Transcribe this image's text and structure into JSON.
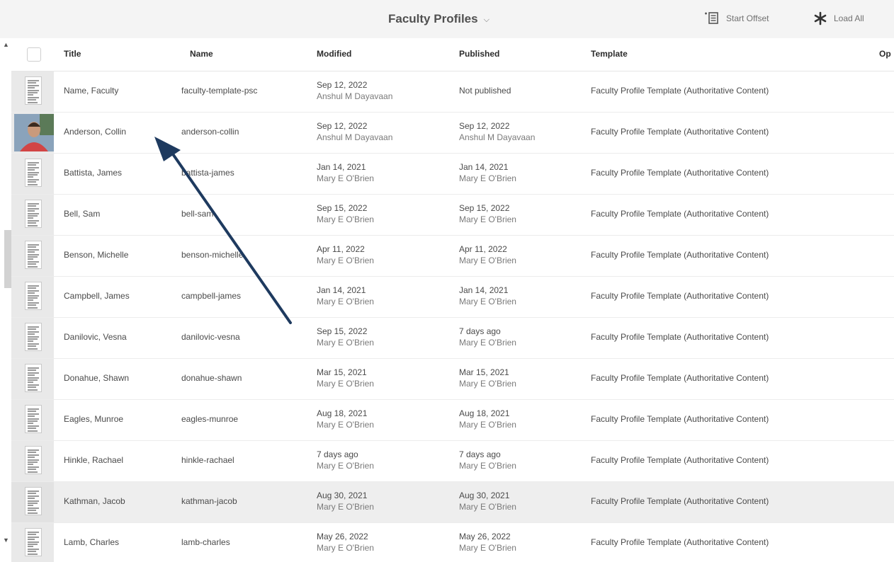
{
  "header": {
    "title": "Faculty Profiles",
    "start_offset": "Start Offset",
    "load_all": "Load All"
  },
  "columns": {
    "title": "Title",
    "name": "Name",
    "modified": "Modified",
    "published": "Published",
    "template": "Template",
    "truncated": "Op"
  },
  "rows": [
    {
      "title": "Name, Faculty",
      "name": "faculty-template-psc",
      "mod_date": "Sep 12, 2022",
      "mod_by": "Anshul M Dayavaan",
      "pub_date": "Not published",
      "pub_by": "",
      "template": "Faculty Profile Template (Authoritative Content)",
      "thumb": "document-icon"
    },
    {
      "title": "Anderson, Collin",
      "name": "anderson-collin",
      "mod_date": "Sep 12, 2022",
      "mod_by": "Anshul M Dayavaan",
      "pub_date": "Sep 12, 2022",
      "pub_by": "Anshul M Dayavaan",
      "template": "Faculty Profile Template (Authoritative Content)",
      "thumb": "profile-photo"
    },
    {
      "title": "Battista, James",
      "name": "battista-james",
      "mod_date": "Jan 14, 2021",
      "mod_by": "Mary E O'Brien",
      "pub_date": "Jan 14, 2021",
      "pub_by": "Mary E O'Brien",
      "template": "Faculty Profile Template (Authoritative Content)",
      "thumb": "document-icon"
    },
    {
      "title": "Bell, Sam",
      "name": "bell-sam",
      "mod_date": "Sep 15, 2022",
      "mod_by": "Mary E O'Brien",
      "pub_date": "Sep 15, 2022",
      "pub_by": "Mary E O'Brien",
      "template": "Faculty Profile Template (Authoritative Content)",
      "thumb": "document-icon"
    },
    {
      "title": "Benson, Michelle",
      "name": "benson-michelle",
      "mod_date": "Apr 11, 2022",
      "mod_by": "Mary E O'Brien",
      "pub_date": "Apr 11, 2022",
      "pub_by": "Mary E O'Brien",
      "template": "Faculty Profile Template (Authoritative Content)",
      "thumb": "document-icon"
    },
    {
      "title": "Campbell, James",
      "name": "campbell-james",
      "mod_date": "Jan 14, 2021",
      "mod_by": "Mary E O'Brien",
      "pub_date": "Jan 14, 2021",
      "pub_by": "Mary E O'Brien",
      "template": "Faculty Profile Template (Authoritative Content)",
      "thumb": "document-icon"
    },
    {
      "title": "Danilovic, Vesna",
      "name": "danilovic-vesna",
      "mod_date": "Sep 15, 2022",
      "mod_by": "Mary E O'Brien",
      "pub_date": "7 days ago",
      "pub_by": "Mary E O'Brien",
      "template": "Faculty Profile Template (Authoritative Content)",
      "thumb": "document-icon"
    },
    {
      "title": "Donahue, Shawn",
      "name": "donahue-shawn",
      "mod_date": "Mar 15, 2021",
      "mod_by": "Mary E O'Brien",
      "pub_date": "Mar 15, 2021",
      "pub_by": "Mary E O'Brien",
      "template": "Faculty Profile Template (Authoritative Content)",
      "thumb": "document-icon"
    },
    {
      "title": "Eagles, Munroe",
      "name": "eagles-munroe",
      "mod_date": "Aug 18, 2021",
      "mod_by": "Mary E O'Brien",
      "pub_date": "Aug 18, 2021",
      "pub_by": "Mary E O'Brien",
      "template": "Faculty Profile Template (Authoritative Content)",
      "thumb": "document-icon"
    },
    {
      "title": "Hinkle, Rachael",
      "name": "hinkle-rachael",
      "mod_date": "7 days ago",
      "mod_by": "Mary E O'Brien",
      "pub_date": "7 days ago",
      "pub_by": "Mary E O'Brien",
      "template": "Faculty Profile Template (Authoritative Content)",
      "thumb": "document-icon"
    },
    {
      "title": "Kathman, Jacob",
      "name": "kathman-jacob",
      "mod_date": "Aug 30, 2021",
      "mod_by": "Mary E O'Brien",
      "pub_date": "Aug 30, 2021",
      "pub_by": "Mary E O'Brien",
      "template": "Faculty Profile Template (Authoritative Content)",
      "thumb": "document-icon",
      "highlighted": true
    },
    {
      "title": "Lamb, Charles",
      "name": "lamb-charles",
      "mod_date": "May 26, 2022",
      "mod_by": "Mary E O'Brien",
      "pub_date": "May 26, 2022",
      "pub_by": "Mary E O'Brien",
      "template": "Faculty Profile Template (Authoritative Content)",
      "thumb": "document-icon"
    }
  ],
  "colors": {
    "annotation_arrow": "#1e3a5f",
    "topbar": "#f4f4f4",
    "highlight_row": "#eeeeee"
  },
  "annotation": {
    "type": "arrow",
    "points_to": "Anderson, Collin"
  }
}
